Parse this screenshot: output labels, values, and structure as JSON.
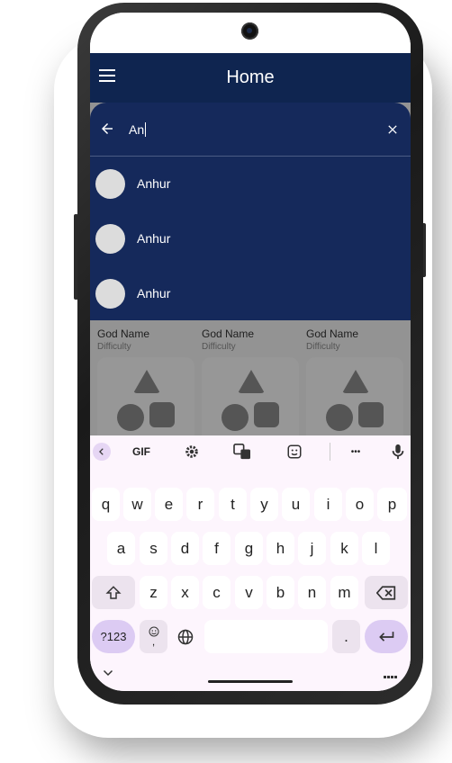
{
  "app": {
    "title": "Home"
  },
  "search": {
    "query": "An",
    "results": [
      {
        "label": "Anhur"
      },
      {
        "label": "Anhur"
      },
      {
        "label": "Anhur"
      }
    ]
  },
  "cards": [
    {
      "name": "God Name",
      "subtitle": "Difficulty"
    },
    {
      "name": "God Name",
      "subtitle": "Difficulty"
    },
    {
      "name": "God Name",
      "subtitle": "Difficulty"
    }
  ],
  "keyboard": {
    "toolbar": {
      "gif_label": "GIF",
      "more_label": "•••"
    },
    "row1": [
      "q",
      "w",
      "e",
      "r",
      "t",
      "y",
      "u",
      "i",
      "o",
      "p"
    ],
    "row2": [
      "a",
      "s",
      "d",
      "f",
      "g",
      "h",
      "j",
      "k",
      "l"
    ],
    "row3": [
      "z",
      "x",
      "c",
      "v",
      "b",
      "n",
      "m"
    ],
    "numbers_label": "?123",
    "period_label": ".",
    "emoji_comma_label": ","
  },
  "colors": {
    "appbar": "#0f2550",
    "search_panel": "#15295b",
    "keyboard_bg": "#fdf5fd",
    "accent_key": "#dccbf3"
  }
}
